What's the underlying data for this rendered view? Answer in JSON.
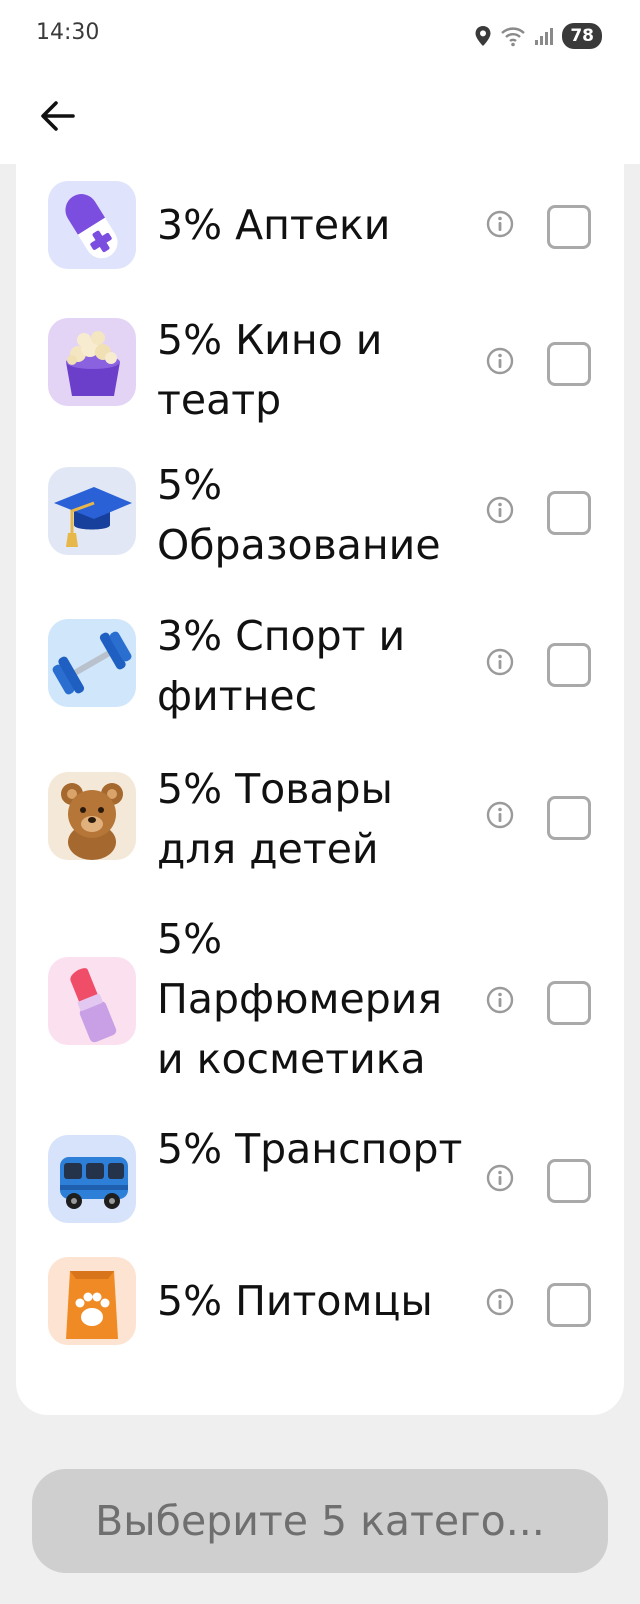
{
  "status_bar": {
    "time": "14:30",
    "battery": "78"
  },
  "header": {
    "back_icon": "arrow-left-icon"
  },
  "categories": [
    {
      "label": "3% Аптеки",
      "icon": "pill-icon"
    },
    {
      "label": "5% Кино и театр",
      "icon": "popcorn-icon"
    },
    {
      "label": "5% Образование",
      "icon": "graduation-cap-icon"
    },
    {
      "label": "3% Спорт и фитнес",
      "icon": "dumbbell-icon"
    },
    {
      "label": "5% Товары для детей",
      "icon": "teddy-bear-icon"
    },
    {
      "label": "5% Парфюмерия и косметика",
      "icon": "lipstick-icon"
    },
    {
      "label": "5% Транспорт",
      "icon": "bus-icon"
    },
    {
      "label": "5% Питомцы",
      "icon": "pet-food-icon"
    }
  ],
  "cta": {
    "label": "Выберите 5 катего..."
  },
  "colors": {
    "background": "#efefef",
    "card": "#ffffff",
    "button_disabled": "#cfcfcf",
    "button_text": "#6f6f6f"
  }
}
